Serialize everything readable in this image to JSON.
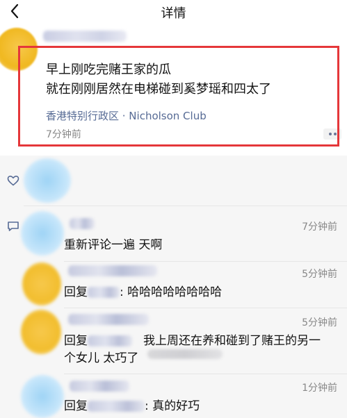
{
  "nav": {
    "title": "详情",
    "back_icon": "chevron-left-icon"
  },
  "post": {
    "line1": "早上刚吃完赌王家的瓜",
    "line2": "就在刚刚居然在电梯碰到奚梦瑶和四太了",
    "location": "香港特别行政区 · Nicholson Club",
    "time": "7分钟前",
    "more_icon": "more-dots-icon"
  },
  "likes": {
    "icon": "heart-icon"
  },
  "comments": {
    "icon": "comment-icon",
    "items": [
      {
        "time": "7分钟前",
        "text": "重新评论一遍 天啊"
      },
      {
        "time": "5分钟前",
        "prefix": "回复",
        "text": ": 哈哈哈哈哈哈哈哈"
      },
      {
        "time": "5分钟前",
        "prefix": "回复",
        "text": "我上周还在养和碰到了赌王的另一",
        "text_line2": "个女儿 太巧了"
      },
      {
        "time": "1分钟前",
        "prefix": "回复",
        "text": ": 真的好巧"
      }
    ]
  },
  "colors": {
    "highlight": "#e5373a",
    "link": "#576b95",
    "feed_bg": "#f6f6f6"
  }
}
